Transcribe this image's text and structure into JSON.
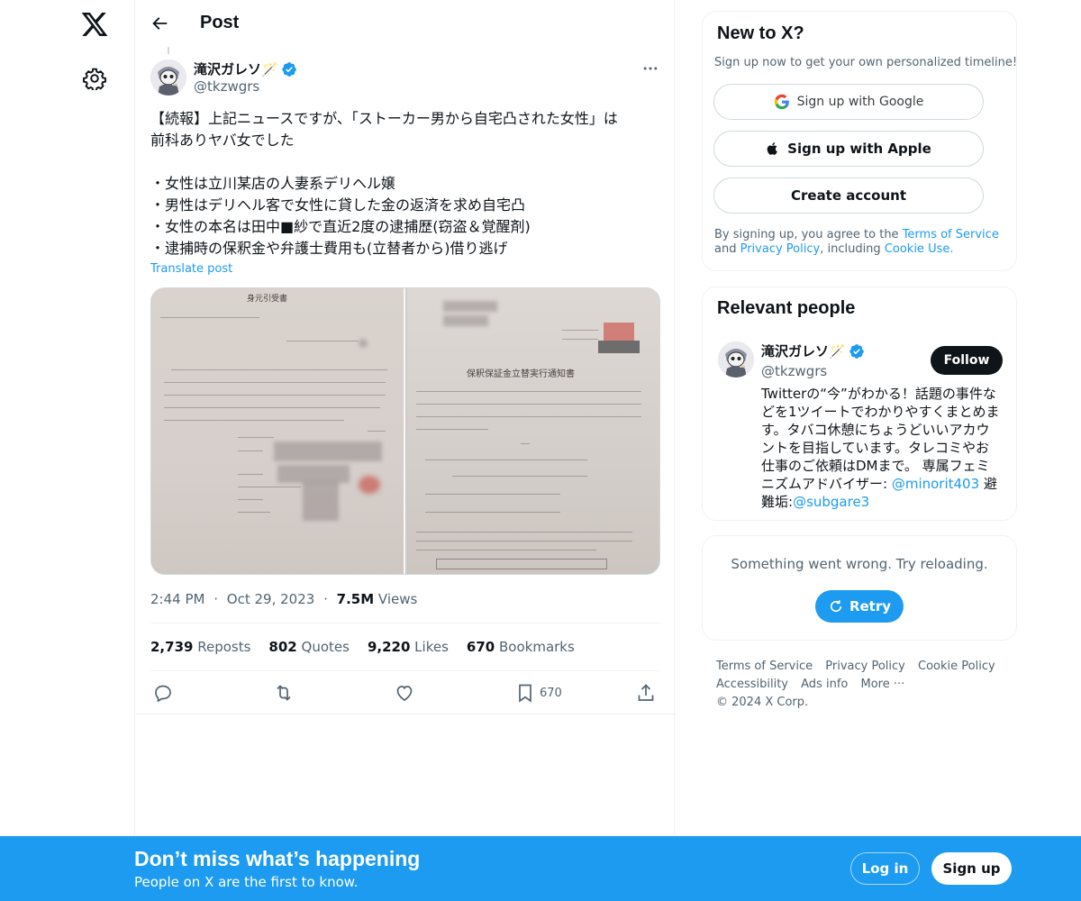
{
  "header": {
    "title": "Post"
  },
  "post": {
    "author_name": "滝沢ガレソ🪄",
    "author_handle": "@tkzwgrs",
    "text": "【続報】上記ニュースですが、「ストーカー男から自宅凸された女性」は\n前科ありヤバ女でした\n\n・女性は立川某店の人妻系デリヘル嬢\n・男性はデリヘル客で女性に貸した金の返済を求め自宅凸\n・女性の本名は田中■紗で直近2度の逮捕歴(窃盗＆覚醒剤)\n・逮捕時の保釈金や弁護士費用も(立替者から)借り逃げ",
    "translate": "Translate post",
    "doc1_title": "身元引受書",
    "doc2_title": "保釈保証金立替実行通知書",
    "time": "2:44 PM",
    "dot1": "·",
    "date": "Oct 29, 2023",
    "dot2": "·",
    "views_count": "7.5M",
    "views_label": "Views",
    "reposts_count": "2,739",
    "reposts_label": "Reposts",
    "quotes_count": "802",
    "quotes_label": "Quotes",
    "likes_count": "9,220",
    "likes_label": "Likes",
    "bookmarks_count": "670",
    "bookmarks_label": "Bookmarks",
    "bookmark_action_count": "670"
  },
  "signup_card": {
    "title": "New to X?",
    "subtitle": "Sign up now to get your own personalized timeline!",
    "google": "Sign up with Google",
    "apple": "Sign up with Apple",
    "create": "Create account",
    "legal_pre": "By signing up, you agree to the ",
    "terms": "Terms of Service",
    "legal_and": " and ",
    "privacy": "Privacy Policy",
    "legal_including": ", including ",
    "cookie": "Cookie Use",
    "legal_end": "."
  },
  "relevant": {
    "title": "Relevant people",
    "name": "滝沢ガレソ🪄",
    "handle": "@tkzwgrs",
    "follow": "Follow",
    "bio_text": "Twitterの“今”がわかる！話題の事件などを1ツイートでわかりやすくまとめます。タバコ休憩にちょうどいいアカウントを目指しています。タレコミやお仕事のご依頼はDMまで。 専属フェミニズムアドバイザー: ",
    "bio_link1": "@minorit403",
    "bio_mid": " 避難垢:",
    "bio_link2": "@subgare3"
  },
  "error_card": {
    "message": "Something went wrong. Try reloading.",
    "retry": "Retry"
  },
  "footer": {
    "links": [
      "Terms of Service",
      "Privacy Policy",
      "Cookie Policy",
      "Accessibility",
      "Ads info",
      "More ···",
      "© 2024 X Corp."
    ]
  },
  "bottom_bar": {
    "title": "Don’t miss what’s happening",
    "subtitle": "People on X are the first to know.",
    "login": "Log in",
    "signup": "Sign up"
  },
  "colors": {
    "accent": "#1d9bf0",
    "text": "#0f1419",
    "muted": "#536471",
    "border": "#eff3f4"
  }
}
